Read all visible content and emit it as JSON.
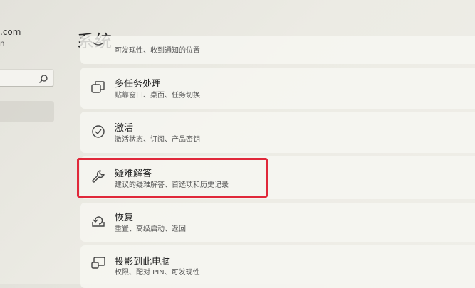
{
  "window": {
    "title": "系统"
  },
  "account": {
    "email_fragment": ".com",
    "sub_fragment": "n"
  },
  "search": {
    "placeholder": ""
  },
  "settings_items": [
    {
      "title": "",
      "description": "可发现性、收到通知的位置",
      "icon": "partial-icon"
    },
    {
      "title": "多任务处理",
      "description": "贴靠窗口、桌面、任务切换",
      "icon": "multitasking-icon"
    },
    {
      "title": "激活",
      "description": "激活状态、订阅、产品密钥",
      "icon": "activation-check-icon"
    },
    {
      "title": "疑难解答",
      "description": "建议的疑难解答、首选项和历史记录",
      "icon": "wrench-icon"
    },
    {
      "title": "恢复",
      "description": "重置、高级启动、返回",
      "icon": "recovery-icon"
    },
    {
      "title": "投影到此电脑",
      "description": "权限、配对 PIN、可发现性",
      "icon": "projection-icon"
    }
  ],
  "highlight": {
    "color": "#e0283a",
    "target": "疑难解答"
  }
}
